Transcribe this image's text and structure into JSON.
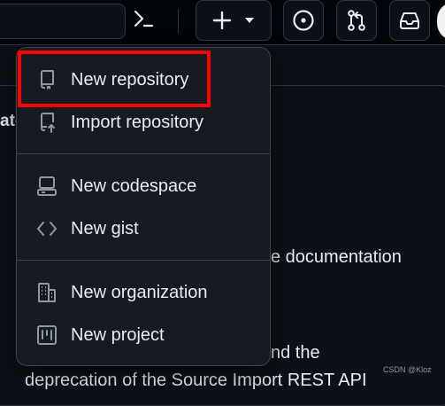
{
  "menu": {
    "items": [
      {
        "label": "New repository",
        "icon": "repo-icon"
      },
      {
        "label": "Import repository",
        "icon": "repo-push-icon"
      },
      {
        "label": "New codespace",
        "icon": "codespaces-icon"
      },
      {
        "label": "New gist",
        "icon": "code-icon"
      },
      {
        "label": "New organization",
        "icon": "organization-icon"
      },
      {
        "label": "New project",
        "icon": "project-icon"
      }
    ]
  },
  "background": {
    "fragment_1": "ate",
    "fragment_2": "e documentation",
    "fragment_3": "nd the",
    "fragment_4": "deprecation of the Source Import REST API"
  },
  "watermark": "CSDN @Kloz",
  "colors": {
    "highlight": "#ff0000",
    "menu_bg": "#161b22",
    "page_bg": "#0d1117"
  }
}
